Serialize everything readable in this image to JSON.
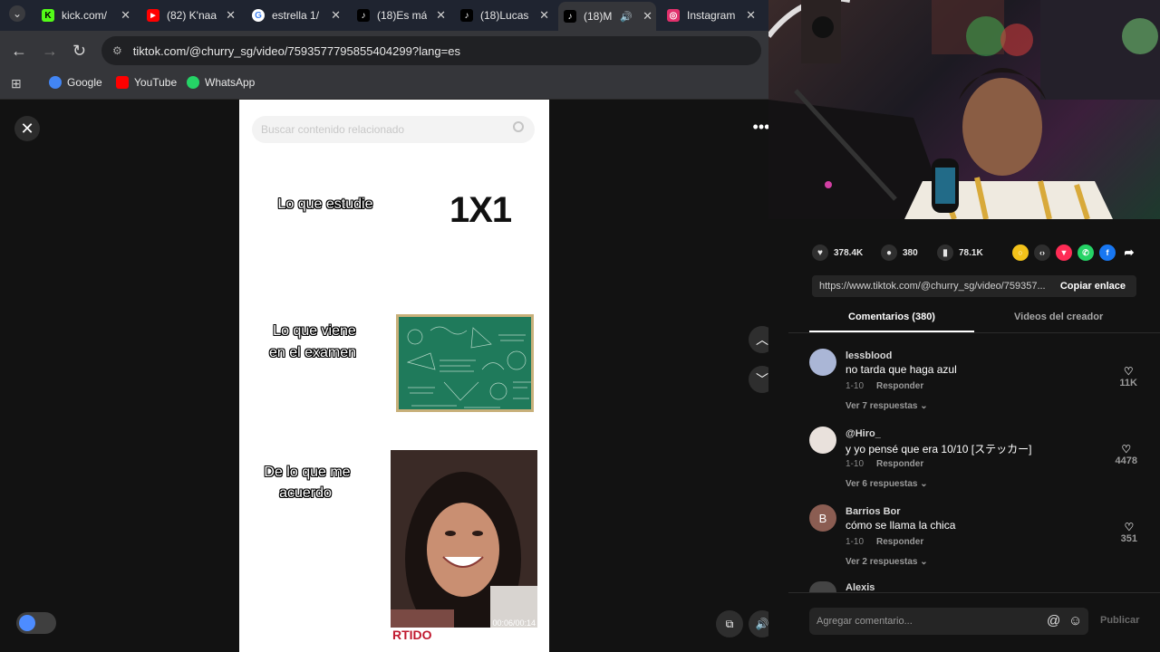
{
  "browser": {
    "tabs": [
      {
        "title": "kick.com/",
        "favicon_color": "#53fc18",
        "favicon_glyph": "K"
      },
      {
        "title": "(82) K'naa",
        "favicon_color": "#ff0000",
        "favicon_glyph": "▶"
      },
      {
        "title": "estrella 1/",
        "favicon_color": "#ffffff",
        "favicon_glyph": "G"
      },
      {
        "title": "(18)Es má",
        "favicon_color": "#000000",
        "favicon_glyph": "♪"
      },
      {
        "title": "(18)Lucas",
        "favicon_color": "#000000",
        "favicon_glyph": "♪"
      },
      {
        "title": "(18)M",
        "favicon_color": "#000000",
        "favicon_glyph": "♪"
      },
      {
        "title": "Instagram",
        "favicon_color": "#e1306c",
        "favicon_glyph": "◎"
      }
    ],
    "url": "tiktok.com/@churry_sg/video/7593577795855404299?lang=es",
    "bookmarks": [
      {
        "label": "Google",
        "icon_color": "#4285f4"
      },
      {
        "label": "YouTube",
        "icon_color": "#ff0000"
      },
      {
        "label": "WhatsApp",
        "icon_color": "#25d366"
      }
    ]
  },
  "video": {
    "search_placeholder": "Buscar contenido relacionado",
    "panel1_left": "Lo que estudie",
    "panel1_right": "1X1",
    "panel2_left_line1": "Lo que viene",
    "panel2_left_line2": "en el examen",
    "panel3_left_line1": "De lo que me",
    "panel3_left_line2": "acuerdo",
    "timestamp": "00:06/00:14",
    "overlay_red_text": "RTIDO"
  },
  "stats": {
    "likes": "378.4K",
    "comments": "380",
    "saves": "78.1K"
  },
  "link": {
    "url": "https://www.tiktok.com/@churry_sg/video/759357...",
    "copy_label": "Copiar enlace"
  },
  "tabs": {
    "comments": "Comentarios (380)",
    "creator": "Videos del creador"
  },
  "comments": [
    {
      "user": "lessblood",
      "text": "no tarda que haga azul",
      "date": "1-10",
      "reply": "Responder",
      "replies": "Ver 7 respuestas",
      "likes": "11K",
      "avatar_color": "#aab6d6",
      "initial": ""
    },
    {
      "user": "@Hiro_",
      "text": "y yo pensé que era 10/10 [ステッカー]",
      "date": "1-10",
      "reply": "Responder",
      "replies": "Ver 6 respuestas",
      "likes": "4478",
      "avatar_color": "#e9e1dc",
      "initial": ""
    },
    {
      "user": "Barrios Bor",
      "text": "cómo se llama la chica",
      "date": "1-10",
      "reply": "Responder",
      "replies": "Ver 2 respuestas",
      "likes": "351",
      "avatar_color": "#8b5d52",
      "initial": "B"
    }
  ],
  "partial_comment_user": "Alexis",
  "comment_input": {
    "placeholder": "Agregar comentario...",
    "publish": "Publicar"
  }
}
